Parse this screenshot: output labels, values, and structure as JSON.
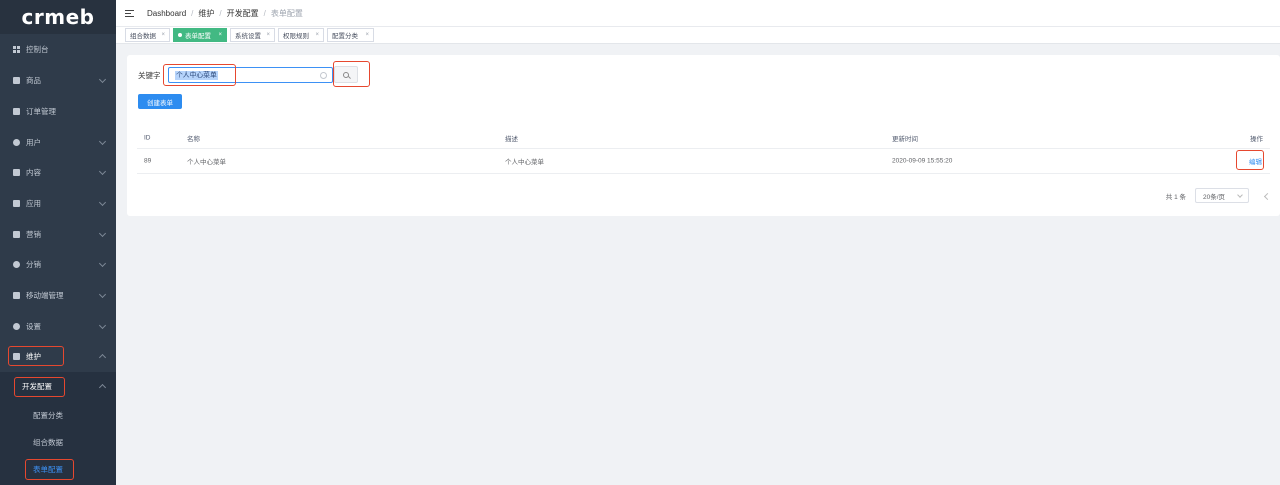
{
  "logo": "crmeb",
  "sidebar": {
    "items": [
      {
        "label": "控制台",
        "icon": "dashboard-grid-icon",
        "chevron": false
      },
      {
        "label": "商品",
        "icon": "shopping-bag-icon",
        "chevron": true
      },
      {
        "label": "订单管理",
        "icon": "order-list-icon",
        "chevron": false
      },
      {
        "label": "用户",
        "icon": "user-icon",
        "chevron": true
      },
      {
        "label": "内容",
        "icon": "chart-content-icon",
        "chevron": true
      },
      {
        "label": "应用",
        "icon": "send-icon",
        "chevron": true
      },
      {
        "label": "营销",
        "icon": "marketing-icon",
        "chevron": true
      },
      {
        "label": "分销",
        "icon": "distribution-icon",
        "chevron": true
      },
      {
        "label": "移动端管理",
        "icon": "mobile-icon",
        "chevron": true
      },
      {
        "label": "设置",
        "icon": "gear-icon",
        "chevron": true
      },
      {
        "label": "维护",
        "icon": "maintenance-icon",
        "chevron": true,
        "expanded": true
      }
    ],
    "submenu_title": "开发配置",
    "submenu_items": [
      {
        "label": "配置分类",
        "active": false
      },
      {
        "label": "组合数据",
        "active": false
      },
      {
        "label": "表单配置",
        "active": true
      }
    ]
  },
  "breadcrumb": [
    "Dashboard",
    "维护",
    "开发配置",
    "表单配置"
  ],
  "tabs": [
    {
      "label": "组合数据",
      "active": false
    },
    {
      "label": "表单配置",
      "active": true
    },
    {
      "label": "系统设置",
      "active": false
    },
    {
      "label": "权限规则",
      "active": false
    },
    {
      "label": "配置分类",
      "active": false
    }
  ],
  "tab_close": "×",
  "search": {
    "label": "关键字",
    "value": "个人中心菜单"
  },
  "create_button": "创建表单",
  "table": {
    "headers": [
      "ID",
      "名称",
      "描述",
      "更新时间",
      "操作"
    ],
    "rows": [
      {
        "id": "89",
        "name": "个人中心菜单",
        "desc": "个人中心菜单",
        "updated": "2020-09-09 15:55:20",
        "action": "编辑"
      }
    ]
  },
  "pagination": {
    "total": "共 1 条",
    "page_size": "20条/页"
  },
  "colors": {
    "sidebar_bg": "#2f3b4a",
    "primary": "#2d8cf0",
    "tab_active": "#42b983",
    "highlight": "#e6482f"
  }
}
